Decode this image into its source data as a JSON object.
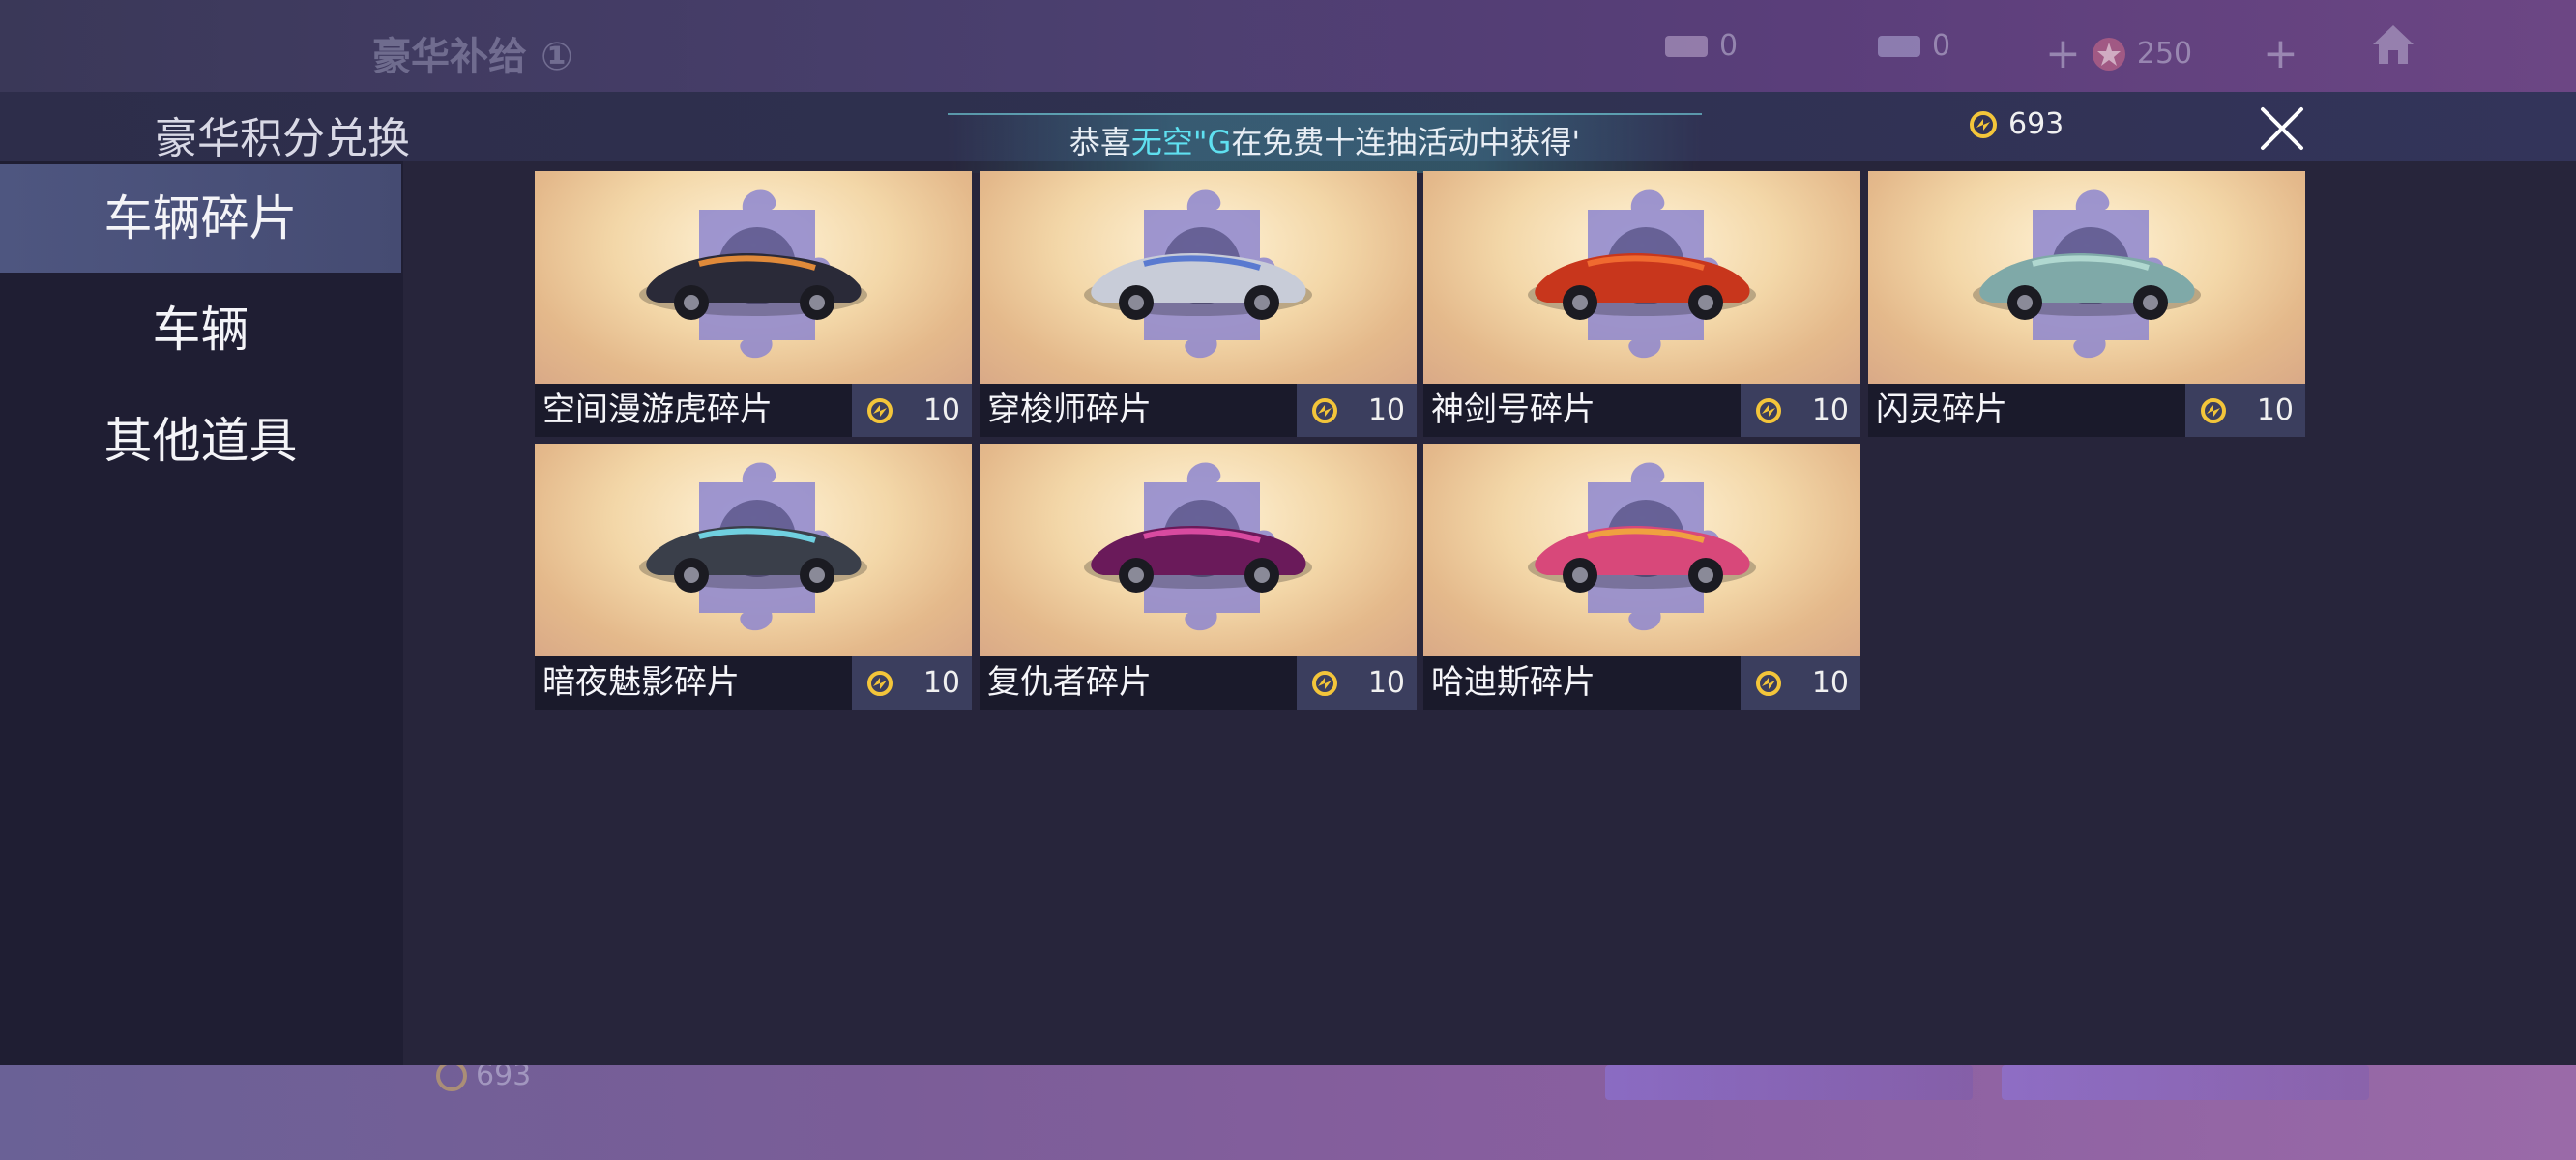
{
  "background": {
    "title": "豪华补给",
    "title_badge": "①",
    "currency_a": "0",
    "currency_b": "0",
    "currency_c": "250",
    "bottom_points": "693"
  },
  "dialog": {
    "title": "豪华积分兑换",
    "ticker": {
      "prefix": "恭喜",
      "highlight": "无空\"G",
      "suffix": "在免费十连抽活动中获得'"
    },
    "points": "693"
  },
  "sidenav": {
    "items": [
      {
        "label": "车辆碎片",
        "active": true
      },
      {
        "label": "车辆",
        "active": false
      },
      {
        "label": "其他道具",
        "active": false
      }
    ]
  },
  "items": [
    {
      "name": "空间漫游虎碎片",
      "price": "10",
      "car_color": "#2a2a38",
      "accent": "#e08a3a"
    },
    {
      "name": "穿梭师碎片",
      "price": "10",
      "car_color": "#c8ccd8",
      "accent": "#5a7ad0"
    },
    {
      "name": "神剑号碎片",
      "price": "10",
      "car_color": "#c8361c",
      "accent": "#f06a30"
    },
    {
      "name": "闪灵碎片",
      "price": "10",
      "car_color": "#7fa9a8",
      "accent": "#b0d8d0"
    },
    {
      "name": "暗夜魅影碎片",
      "price": "10",
      "car_color": "#3a3f4a",
      "accent": "#70d0e0"
    },
    {
      "name": "复仇者碎片",
      "price": "10",
      "car_color": "#6a1a5a",
      "accent": "#d84aa0"
    },
    {
      "name": "哈迪斯碎片",
      "price": "10",
      "car_color": "#d8487a",
      "accent": "#f0a040"
    }
  ],
  "colors": {
    "puzzle": "#8d86cf",
    "coin": "#f3c53a",
    "active_nav": "#4e5680"
  }
}
